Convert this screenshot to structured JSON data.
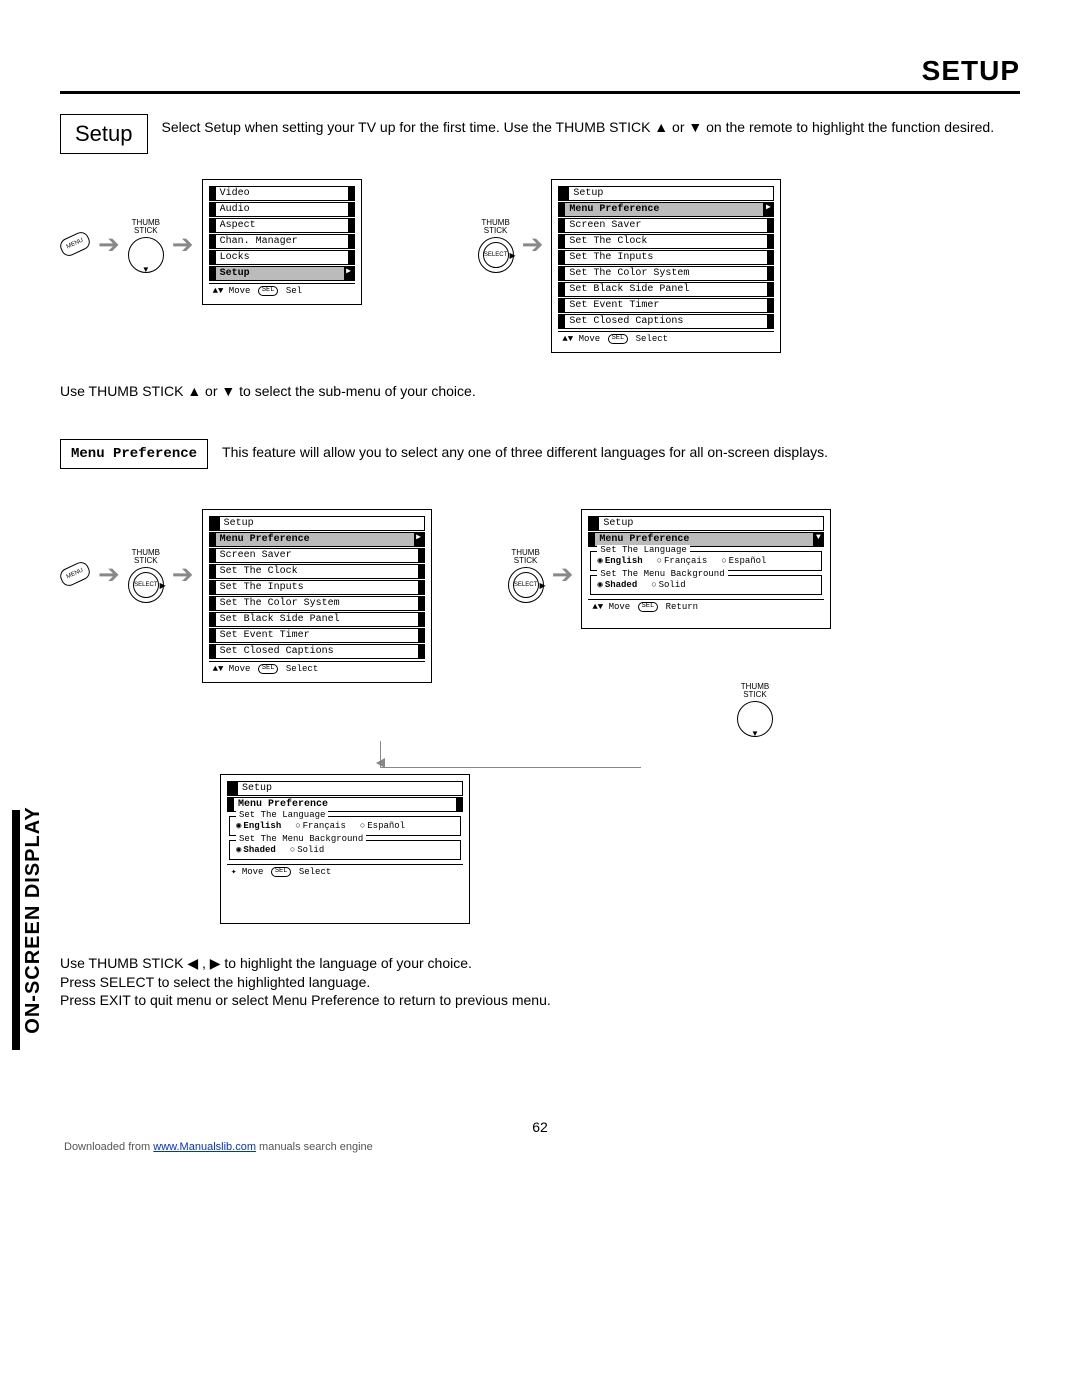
{
  "header": {
    "title": "SETUP"
  },
  "section1": {
    "label": "Setup",
    "desc": "Select Setup when setting your TV up for the first time.  Use the THUMB STICK ▲ or ▼ on the remote to highlight the function desired."
  },
  "flow1": {
    "menu_btn": "MENU",
    "thumb_label": "THUMB\nSTICK",
    "select_label": "SELECT",
    "panelA": {
      "items": [
        "Video",
        "Audio",
        "Aspect",
        "Chan. Manager",
        "Locks",
        "Setup"
      ],
      "selected": "Setup",
      "hint_move": "Move",
      "hint_sel": "Sel"
    },
    "panelB": {
      "title": "Setup",
      "items": [
        "Menu Preference",
        "Screen Saver",
        "Set The Clock",
        "Set The Inputs",
        "Set The Color System",
        "Set Black Side Panel",
        "Set Event Timer",
        "Set Closed Captions"
      ],
      "selected": "Menu Preference",
      "hint_move": "Move",
      "hint_sel": "Select"
    }
  },
  "mid_note": "Use THUMB STICK ▲ or ▼ to select the sub-menu of your choice.",
  "section2": {
    "label": "Menu Preference",
    "desc": "This feature will allow you to select any one of three different languages for all on-screen displays."
  },
  "flow2": {
    "panelA": {
      "title": "Setup",
      "items": [
        "Menu Preference",
        "Screen Saver",
        "Set The Clock",
        "Set The Inputs",
        "Set The Color System",
        "Set Black Side Panel",
        "Set Event Timer",
        "Set Closed Captions"
      ],
      "selected": "Menu Preference",
      "hint_move": "Move",
      "hint_sel": "Select"
    },
    "panelB": {
      "title": "Setup",
      "sub": "Menu Preference",
      "lang_legend": "Set The Language",
      "langs": [
        "English",
        "Français",
        "Español"
      ],
      "lang_sel": "English",
      "bg_legend": "Set The Menu Background",
      "bgs": [
        "Shaded",
        "Solid"
      ],
      "bg_sel": "Shaded",
      "hint_move": "Move",
      "hint_ret": "Return"
    },
    "panelC": {
      "title": "Setup",
      "sub": "Menu Preference",
      "lang_legend": "Set The Language",
      "langs": [
        "English",
        "Français",
        "Español"
      ],
      "lang_sel": "English",
      "bg_legend": "Set The Menu Background",
      "bgs": [
        "Shaded",
        "Solid"
      ],
      "bg_sel": "Shaded",
      "hint_move": "Move",
      "hint_sel": "Select"
    }
  },
  "side_tab": "ON-SCREEN DISPLAY",
  "footer": {
    "l1": "Use THUMB STICK ◀ , ▶ to highlight the language of your choice.",
    "l2": "Press SELECT to select the highlighted language.",
    "l3": "Press EXIT to quit menu or select Menu Preference to return to previous menu."
  },
  "page_num": "62",
  "download": {
    "pre": "Downloaded from ",
    "link": "www.Manualslib.com",
    "post": " manuals search engine"
  }
}
